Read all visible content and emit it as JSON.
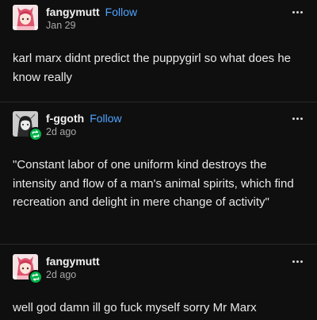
{
  "posts": [
    {
      "username": "fangymutt",
      "follow_label": "Follow",
      "timestamp": "Jan 29",
      "reblog": false,
      "text": "karl marx didnt predict the puppygirl so what does he know really"
    },
    {
      "username": "f-ggoth",
      "follow_label": "Follow",
      "timestamp": "2d ago",
      "reblog": true,
      "text": "\"Constant labor of one uniform kind destroys the intensity and flow of a man's animal spirits, which find recreation and delight in mere change of activity\""
    },
    {
      "username": "fangymutt",
      "follow_label": "",
      "timestamp": "2d ago",
      "reblog": true,
      "text": "well god damn ill go fuck myself sorry Mr Marx"
    }
  ],
  "icons": {
    "more": "more-options-icon",
    "reblog": "reblog-icon"
  },
  "colors": {
    "background": "#0f0f0f",
    "follow": "#4fa3ff",
    "reblog_badge": "#00b34a",
    "text": "#e8e8e8",
    "meta": "#a8a8a8"
  }
}
